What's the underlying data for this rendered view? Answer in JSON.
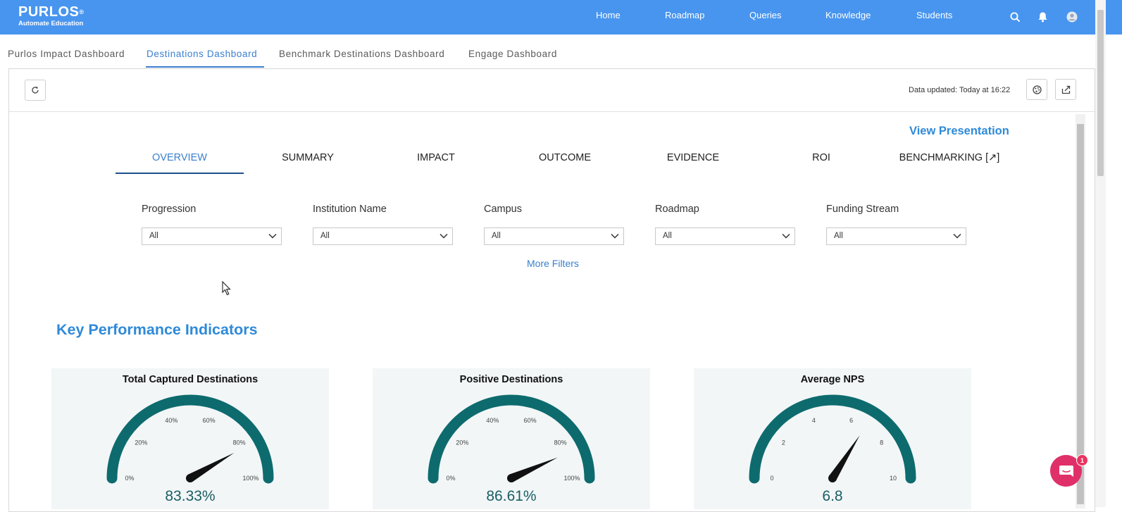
{
  "brand": {
    "name": "PURLOS",
    "trademark": "®",
    "tagline": "Automate Education"
  },
  "nav": [
    "Home",
    "Roadmap",
    "Queries",
    "Knowledge",
    "Students"
  ],
  "icons": {
    "search": "search-icon",
    "notifications": "bell-icon",
    "account": "user-icon"
  },
  "dashboard_tabs": [
    {
      "label": "Purlos Impact Dashboard",
      "active": false
    },
    {
      "label": "Destinations Dashboard",
      "active": true
    },
    {
      "label": "Benchmark Destinations Dashboard",
      "active": false
    },
    {
      "label": "Engage Dashboard",
      "active": false
    }
  ],
  "toolbar": {
    "data_updated": "Data updated: Today at 16:22"
  },
  "view_presentation": "View Presentation",
  "section_tabs": [
    {
      "label": "OVERVIEW",
      "active": true
    },
    {
      "label": "SUMMARY",
      "active": false
    },
    {
      "label": "IMPACT",
      "active": false
    },
    {
      "label": "OUTCOME",
      "active": false
    },
    {
      "label": "EVIDENCE",
      "active": false
    },
    {
      "label": "ROI",
      "active": false
    },
    {
      "label": "BENCHMARKING [↗]",
      "active": false
    }
  ],
  "filters": [
    {
      "label": "Progression",
      "value": "All"
    },
    {
      "label": "Institution Name",
      "value": "All"
    },
    {
      "label": "Campus",
      "value": "All"
    },
    {
      "label": "Roadmap",
      "value": "All"
    },
    {
      "label": "Funding Stream",
      "value": "All"
    }
  ],
  "more_filters": "More Filters",
  "kpi_heading": "Key Performance Indicators",
  "kpis": [
    {
      "title": "Total Captured Destinations",
      "value_text": "83.33%",
      "value": 83.33,
      "max": 100,
      "ticks": [
        "0%",
        "20%",
        "40%",
        "60%",
        "80%",
        "100%"
      ]
    },
    {
      "title": "Positive Destinations",
      "value_text": "86.61%",
      "value": 86.61,
      "max": 100,
      "ticks": [
        "0%",
        "20%",
        "40%",
        "60%",
        "80%",
        "100%"
      ]
    },
    {
      "title": "Average NPS",
      "value_text": "6.8",
      "value": 6.8,
      "max": 10,
      "ticks": [
        "0",
        "2",
        "4",
        "6",
        "8",
        "10"
      ]
    }
  ],
  "chat": {
    "badge": "1"
  },
  "colors": {
    "topbar": "#4895ef",
    "accent": "#2f8ad8",
    "gauge": "#0d6b6e",
    "chat": "#e0306a"
  }
}
